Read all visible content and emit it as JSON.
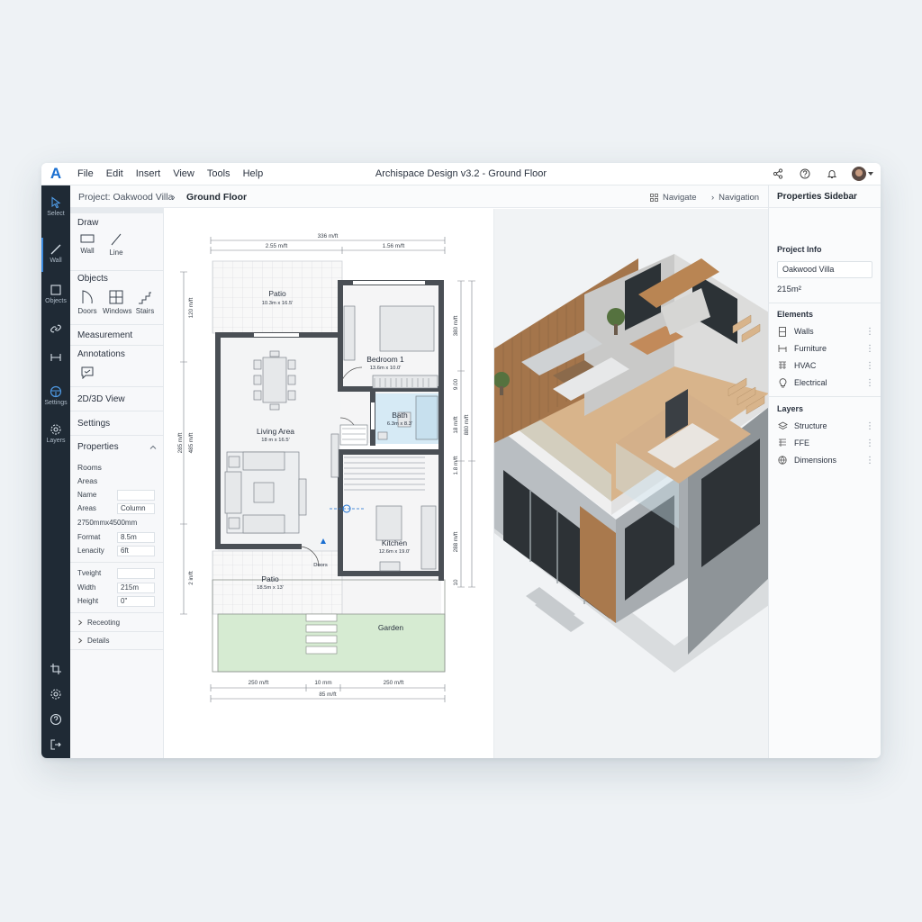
{
  "app": {
    "logo": "A",
    "title": "Archispace Design v3.2 - Ground Floor",
    "menu": [
      "File",
      "Edit",
      "Insert",
      "View",
      "Tools",
      "Help"
    ]
  },
  "breadcrumb": {
    "project": "Project: Oakwood Villa",
    "current": "Ground Floor",
    "navigate": "Navigate",
    "navigation": "Navigation"
  },
  "rail": {
    "select": "Select",
    "wall": "Wall",
    "objects": "Objects",
    "settings": "Settings",
    "layers": "Layers"
  },
  "tools": {
    "select": "Select",
    "draw": "Draw",
    "wall": "Wall",
    "line": "Line",
    "objects": "Objects",
    "doors": "Doors",
    "windows": "Windows",
    "stairs": "Stairs",
    "measurement": "Measurement",
    "annotations": "Annotations",
    "view_2d3d": "2D/3D View",
    "settings": "Settings",
    "properties": "Properties",
    "rooms": "Rooms",
    "areas": "Areas",
    "name_label": "Name",
    "name_value": "",
    "areas_label": "Areas",
    "areas_value": "Column",
    "dims": "2750mmx4500mm",
    "format_label": "Format",
    "format_value": "8.5m",
    "lenacity_label": "Lenacity",
    "lenacity_value": "6ft",
    "tveight_label": "Tveight",
    "tveight_value": "",
    "width_label": "Width",
    "width_value": "215m",
    "height_label": "Height",
    "height_value": "0\"",
    "receoting": "Receoting",
    "details": "Details"
  },
  "plan": {
    "dims": {
      "top": "336 m/ft",
      "top_left": "2.55 m/ft",
      "top_right": "1.56 m/ft",
      "bottom_left": "250 m/ft",
      "bottom_mid": "10 mm",
      "bottom_right": "250 m/ft",
      "bottom_total": "85 m/ft",
      "left_1": "120 m/ft",
      "left_2": "285 m/ft",
      "left_3": "485 m/ft",
      "left_4": "2 in/ft",
      "right_1": "380 m/ft",
      "right_2": "9.00",
      "right_3": "880 m/ft",
      "right_4": "18 m/ft",
      "right_5": "1.8 m/ft",
      "right_6": "288 m/ft",
      "right_7": "10"
    },
    "rooms": {
      "patio_top": "Patio",
      "patio_top_size": "10.3m x 16.5'",
      "bedroom": "Bedroom 1",
      "bedroom_size": "13.6m x 10.0'",
      "bath": "Bath",
      "bath_size": "6.3m x 8.3'",
      "living": "Living Area",
      "living_size": "18 m x 16.5'",
      "kitchen": "Kitchen",
      "kitchen_size": "12.6m x 19.0'",
      "patio_bottom": "Patio",
      "patio_bottom_size": "18.5m x 13'",
      "doors": "Doors",
      "garden": "Garden"
    }
  },
  "sidebar": {
    "title": "Properties Sidebar",
    "project_info": "Project Info",
    "project_name": "Oakwood Villa",
    "area": "215m²",
    "elements": "Elements",
    "element_items": [
      "Walls",
      "Furniture",
      "HVAC",
      "Electrical"
    ],
    "layers": "Layers",
    "layer_items": [
      "Structure",
      "FFE",
      "Dimensions"
    ]
  },
  "colors": {
    "rail": "#1f2a35",
    "accent": "#1a6fd1",
    "wall": "#4a4f55",
    "bath": "#d6eaf5",
    "garden": "#d6ebd2",
    "wood": "#c9a27a"
  }
}
